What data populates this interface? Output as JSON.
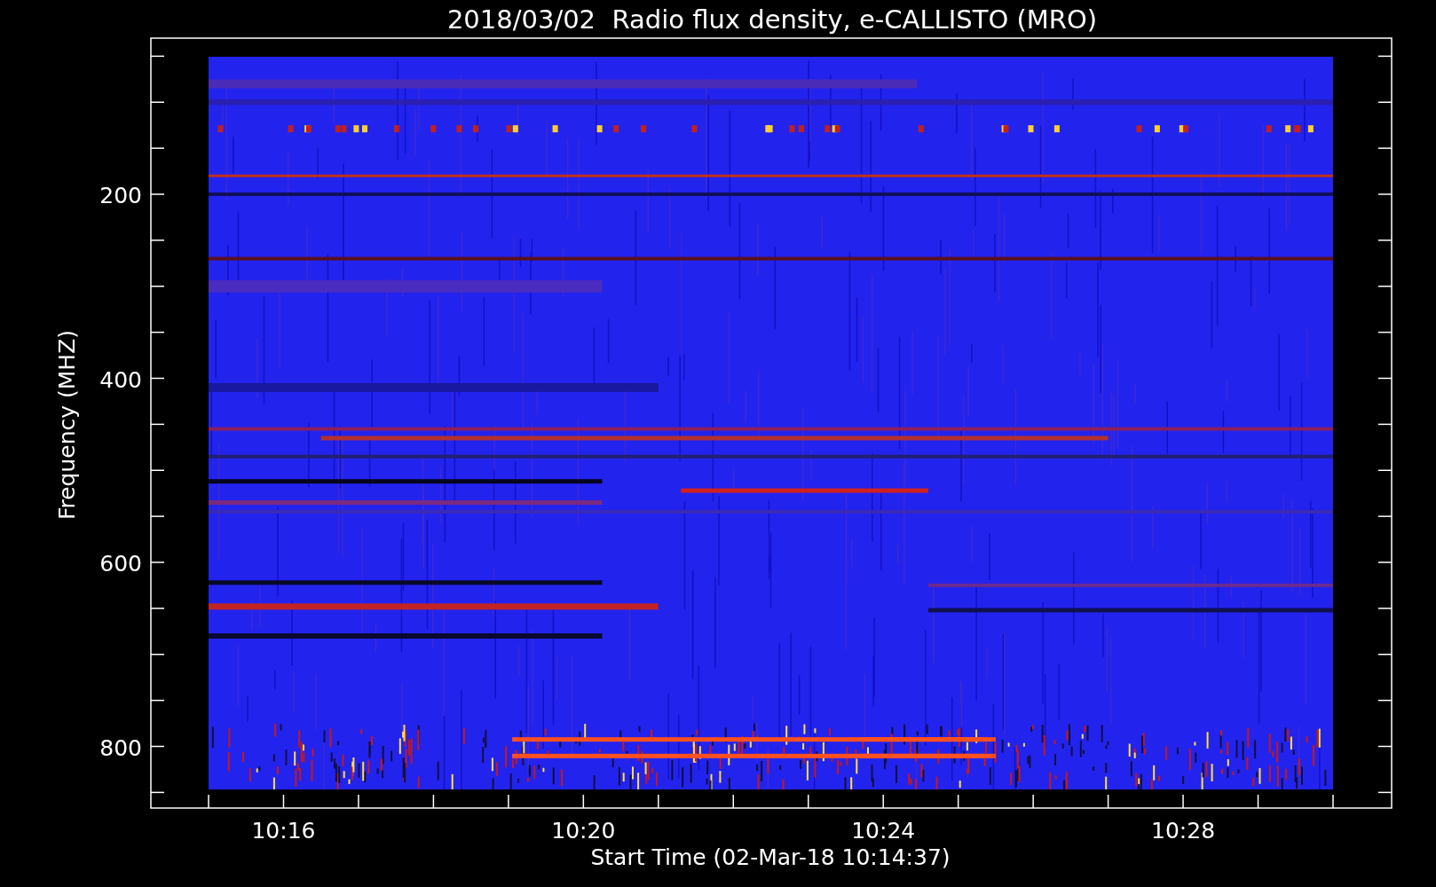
{
  "plot": {
    "title": "2018/03/02  Radio flux density, e-CALLISTO (MRO)",
    "ylabel": "Frequency (MHZ)",
    "yticks": [
      "200",
      "400",
      "600",
      "800"
    ],
    "xticks": [
      "10:16",
      "10:20",
      "10:24",
      "10:28"
    ],
    "xlabel": "Start Time (02-Mar-18 10:14:37)"
  }
}
